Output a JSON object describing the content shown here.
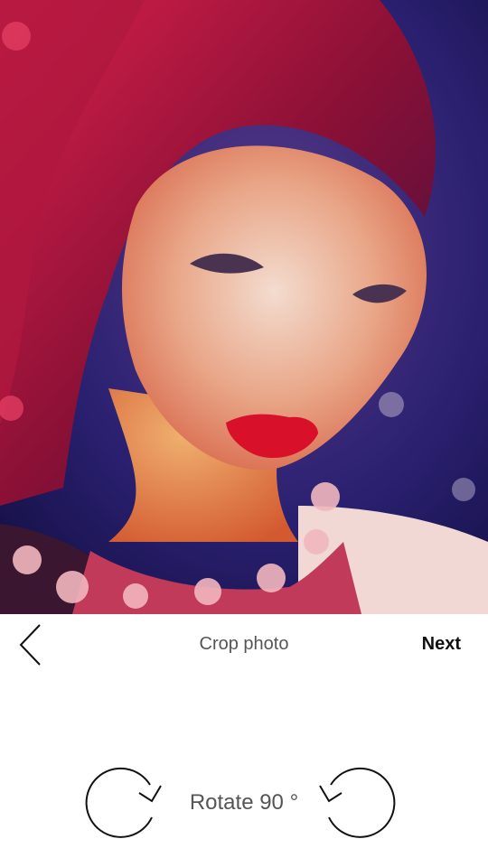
{
  "photo": {
    "subject": "portrait-photo"
  },
  "header": {
    "title": "Crop photo",
    "next_label": "Next",
    "back_icon": "chevron-left-icon"
  },
  "rotate": {
    "label": "Rotate 90 °",
    "clockwise_icon": "rotate-clockwise-icon",
    "counterclockwise_icon": "rotate-counterclockwise-icon"
  },
  "colors": {
    "background": "#ffffff",
    "title_text": "#555555",
    "next_text": "#111111",
    "icon_stroke": "#111111"
  }
}
